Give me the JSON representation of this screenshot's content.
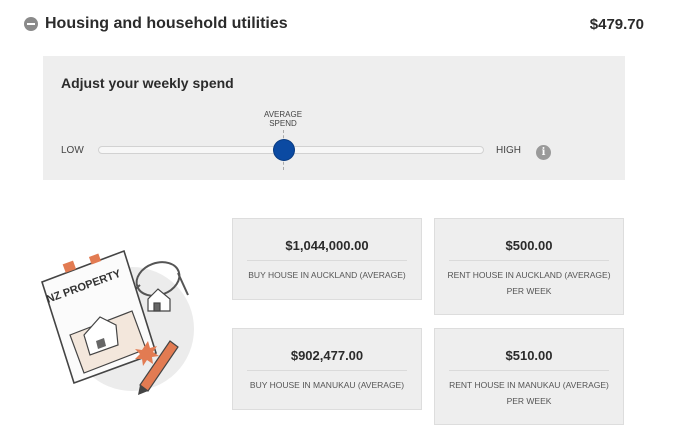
{
  "section": {
    "title": "Housing and household utilities",
    "amount": "$479.70"
  },
  "adjust": {
    "title": "Adjust your weekly spend",
    "average_label": "AVERAGE SPEND",
    "low_label": "LOW",
    "high_label": "HIGH",
    "slider_level": 0.5,
    "info_glyph": "i"
  },
  "illustration": {
    "sign_text": "NZ PROPERTY"
  },
  "cards": [
    {
      "value": "$1,044,000.00",
      "label": "BUY HOUSE IN AUCKLAND (AVERAGE)"
    },
    {
      "value": "$500.00",
      "label": "RENT HOUSE IN AUCKLAND (AVERAGE) PER WEEK"
    },
    {
      "value": "$902,477.00",
      "label": "BUY HOUSE IN MANUKAU (AVERAGE)"
    },
    {
      "value": "$510.00",
      "label": "RENT HOUSE IN MANUKAU (AVERAGE) PER WEEK"
    }
  ],
  "colors": {
    "accent": "#0b4aa2",
    "panel": "#eeeeee"
  }
}
